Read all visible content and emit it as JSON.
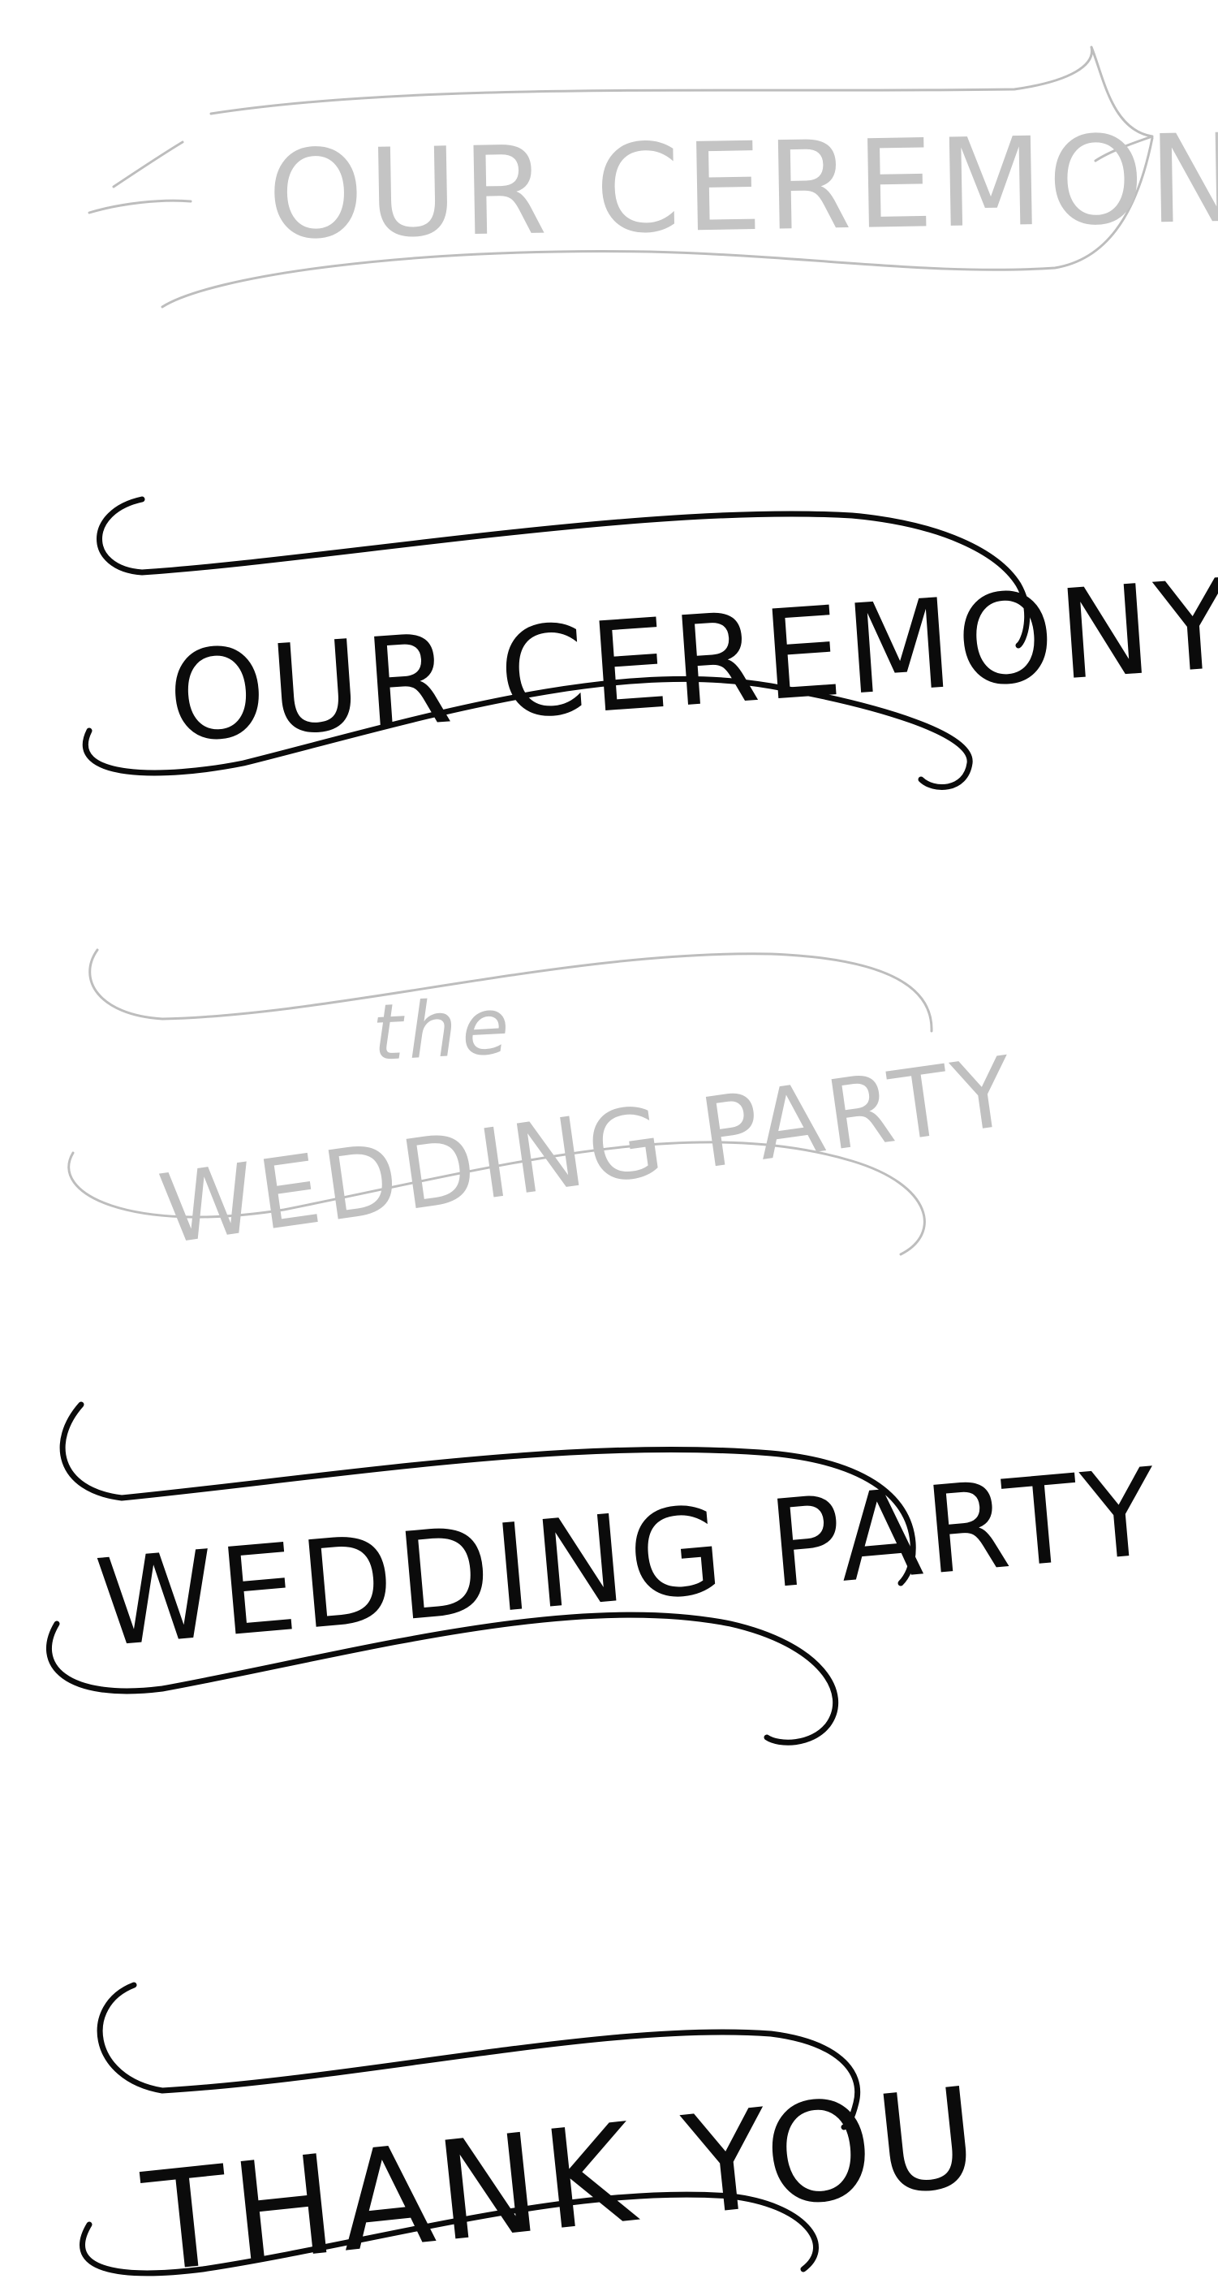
{
  "colors": {
    "sketch": "#bdbdbd",
    "ink": "#0b0b0b",
    "paper": "#ffffff"
  },
  "banners": [
    {
      "kind": "sketch",
      "lines": [
        "OUR CEREMONY"
      ]
    },
    {
      "kind": "final",
      "lines": [
        "OUR CEREMONY"
      ]
    },
    {
      "kind": "sketch",
      "lines": [
        "the",
        "WEDDING PARTY"
      ]
    },
    {
      "kind": "final",
      "lines": [
        "WEDDING PARTY"
      ]
    },
    {
      "kind": "final",
      "lines": [
        "THANK YOU"
      ]
    }
  ]
}
